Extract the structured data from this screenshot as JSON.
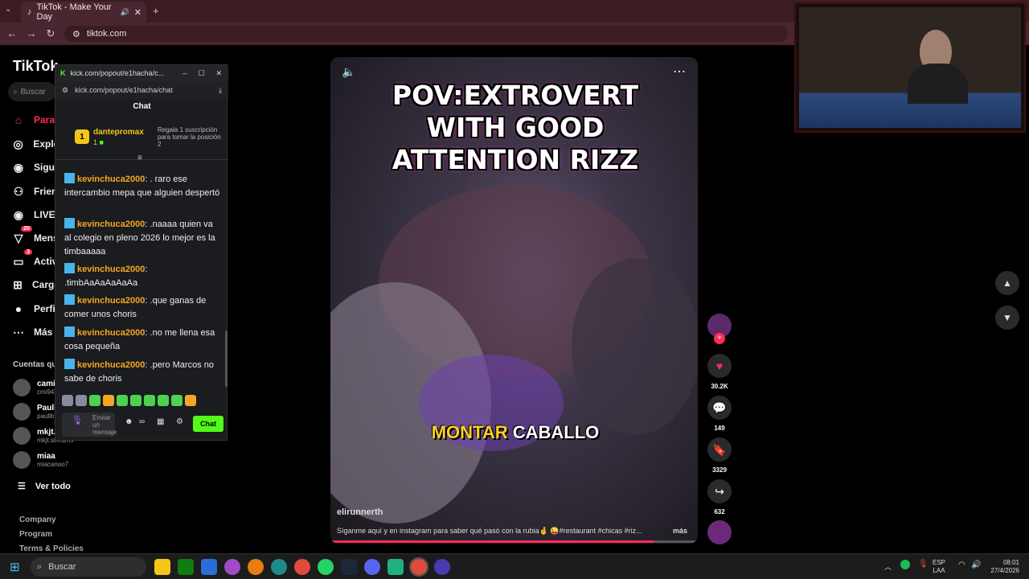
{
  "browser": {
    "tab_title": "TikTok - Make Your Day",
    "url": "tiktok.com"
  },
  "tiktok": {
    "logo": "TikTok",
    "search_placeholder": "Buscar",
    "nav": [
      {
        "label": "Para",
        "icon": "home-icon"
      },
      {
        "label": "Explo",
        "icon": "compass-icon"
      },
      {
        "label": "Sigui",
        "icon": "following-icon"
      },
      {
        "label": "Frien",
        "icon": "friends-icon"
      },
      {
        "label": "LIVE",
        "icon": "live-icon"
      },
      {
        "label": "Mens",
        "icon": "messages-icon",
        "badge": "20"
      },
      {
        "label": "Activ",
        "icon": "activity-icon",
        "badge": "3"
      },
      {
        "label": "Carga",
        "icon": "upload-icon"
      },
      {
        "label": "Perfil",
        "icon": "profile-icon"
      },
      {
        "label": "Más",
        "icon": "more-icon"
      }
    ],
    "following_title": "Cuentas que",
    "accounts": [
      {
        "name": "cami",
        "handle": "cmi94"
      },
      {
        "name": "Pauli",
        "handle": "paulib"
      },
      {
        "name": "mkjt.",
        "handle": "mkjt.streams"
      },
      {
        "name": "miaa",
        "handle": "miacanoo7"
      }
    ],
    "see_all": "Ver todo",
    "footer": [
      "Company",
      "Program",
      "Terms & Policies"
    ]
  },
  "kick": {
    "window_title": "kick.com/popout/e1hacha/c...",
    "url": "kick.com/popout/e1hacha/chat",
    "chat_title": "Chat",
    "leader": {
      "rank": "1",
      "name": "dantepromax",
      "count": "1",
      "gift_text": "Regala 1 suscripción para tomar la posición 2"
    },
    "messages": [
      {
        "user": "kevinchuca2000",
        "text": ". raro ese intercambio mepa que alguien despertó"
      },
      {
        "user": "kevinchuca2000",
        "text": ".naaaa quien va al colegio en pleno 2026 lo mejor es la timbaaaaa"
      },
      {
        "user": "kevinchuca2000",
        "text": ".timbAaAaAaAaAa"
      },
      {
        "user": "kevinchuca2000",
        "text": ".que ganas de comer unos choris"
      },
      {
        "user": "kevinchuca2000",
        "text": ".no me llena esa cosa pequeña"
      },
      {
        "user": "kevinchuca2000",
        "text": ".pero Marcos no sabe de choris"
      }
    ],
    "input_placeholder": "Enviar un mensaje",
    "chat_button": "Chat"
  },
  "video": {
    "title_overlay": "POV:EXTROVERT WITH GOOD ATTENTION RIZZ",
    "caption_overlay_a": "MONTAR",
    "caption_overlay_b": "CABALLO",
    "author": "elirunnerth",
    "description": "Síganme aquí y en instagram para saber qué pasó con la rubia🤞 😜#restaurant #chicas #riz...",
    "more": "más",
    "progress": 0.88
  },
  "actions": {
    "likes": "30.2K",
    "comments": "149",
    "saves": "3329",
    "shares": "632"
  },
  "taskbar": {
    "search": "Buscar",
    "lang_a": "ESP",
    "lang_b": "LAA",
    "time": "08:01",
    "date": "27/4/2026"
  },
  "colors": {
    "tiktok_red": "#fe2c55",
    "kick_green": "#53fc18",
    "chat_user": "#f5a623"
  }
}
